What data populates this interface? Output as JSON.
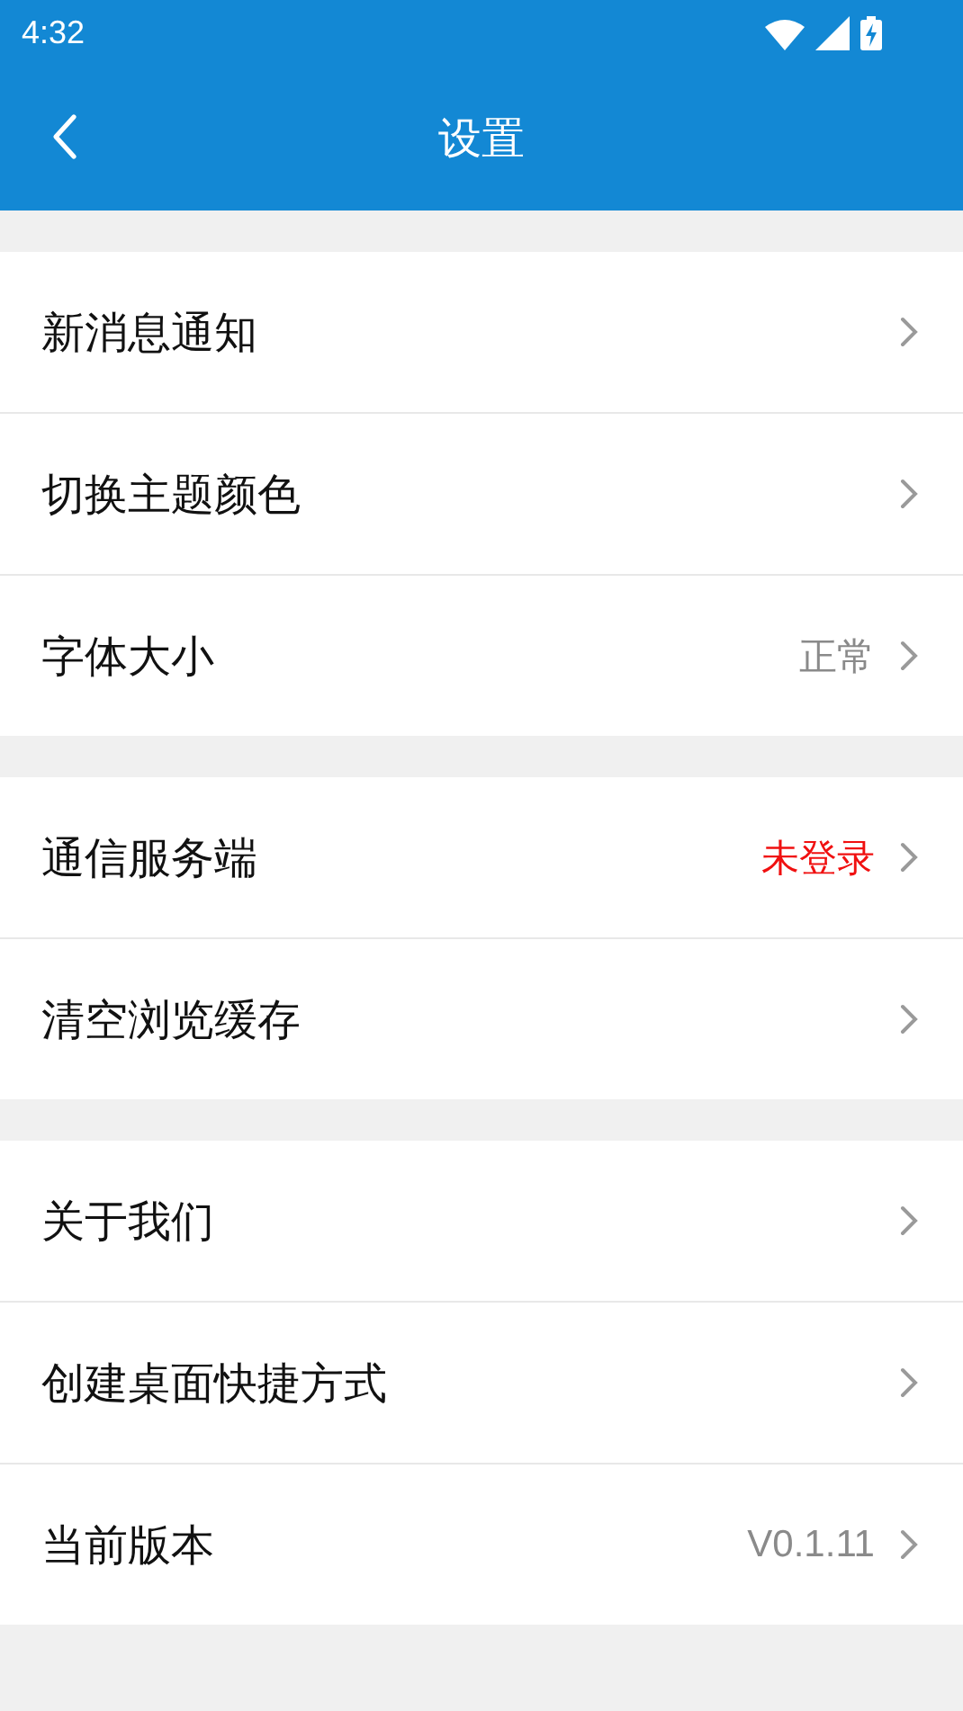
{
  "status_bar": {
    "time": "4:32"
  },
  "app_bar": {
    "title": "设置"
  },
  "groups": [
    {
      "items": [
        {
          "label": "新消息通知"
        },
        {
          "label": "切换主题颜色"
        },
        {
          "label": "字体大小",
          "value": "正常",
          "kind": "normal"
        }
      ]
    },
    {
      "items": [
        {
          "label": "通信服务端",
          "value": "未登录",
          "kind": "warning"
        },
        {
          "label": "清空浏览缓存"
        }
      ]
    },
    {
      "items": [
        {
          "label": "关于我们"
        },
        {
          "label": "创建桌面快捷方式"
        },
        {
          "label": "当前版本",
          "value": "V0.1.11",
          "kind": "normal"
        }
      ]
    }
  ]
}
